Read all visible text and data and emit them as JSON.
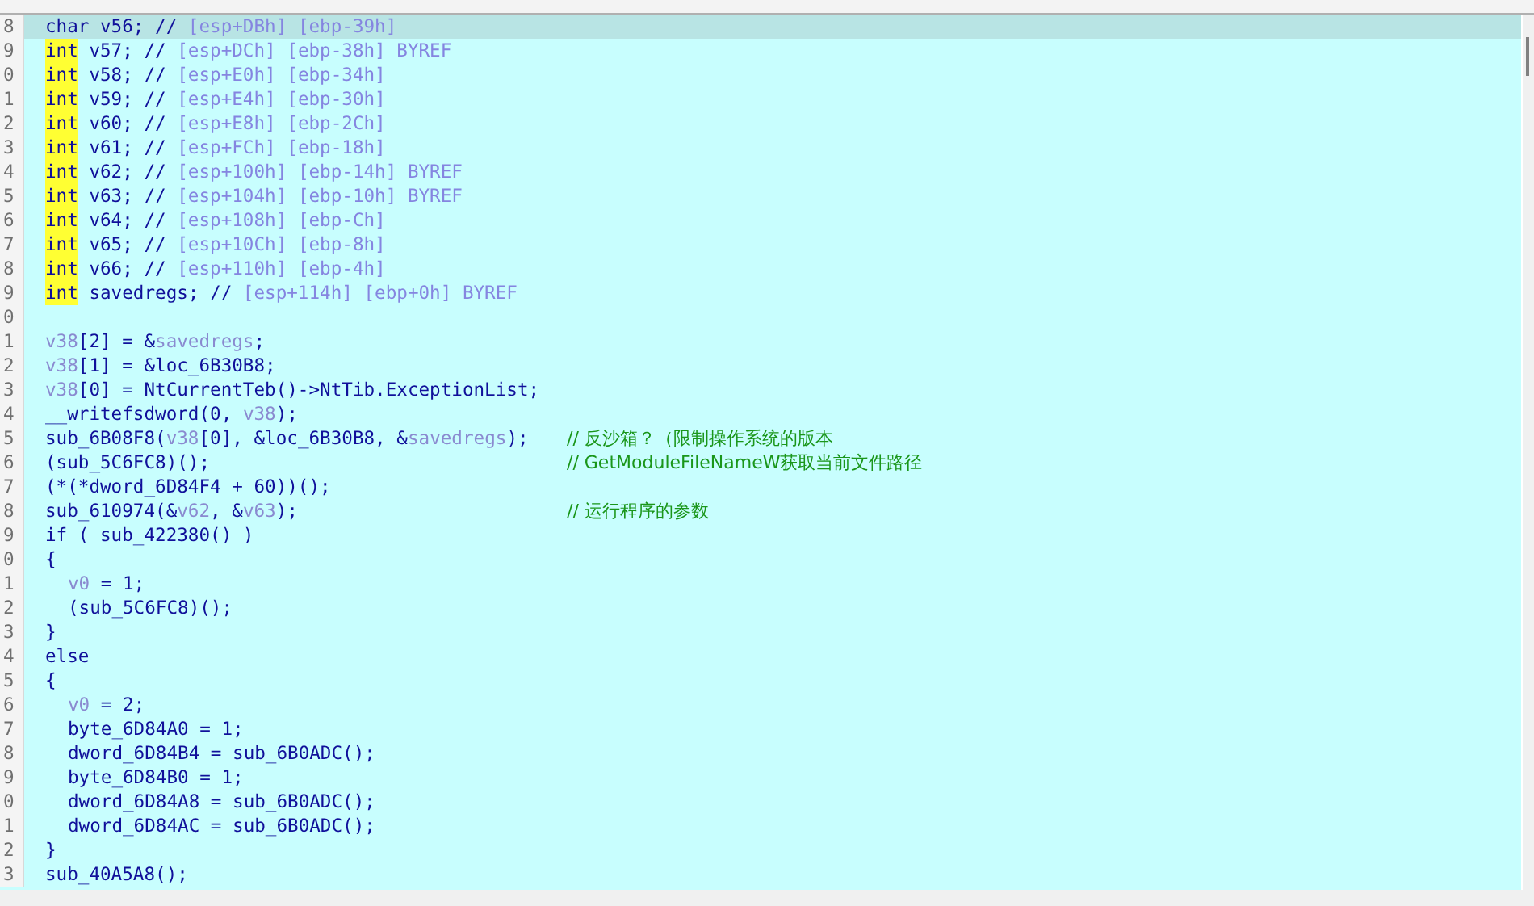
{
  "code_lines": [
    {
      "num": "8",
      "selected": true,
      "tokens": [
        {
          "text": "char v56; //",
          "kind": "plain"
        },
        {
          "text": " [esp+DBh] [ebp-39h]",
          "kind": "comment"
        }
      ]
    },
    {
      "num": "9",
      "selected": false,
      "tokens": [
        {
          "text": "int",
          "kind": "match"
        },
        {
          "text": " v57; //",
          "kind": "plain"
        },
        {
          "text": " [esp+DCh] [ebp-38h] BYREF",
          "kind": "comment"
        }
      ]
    },
    {
      "num": "0",
      "selected": false,
      "tokens": [
        {
          "text": "int",
          "kind": "match"
        },
        {
          "text": " v58; //",
          "kind": "plain"
        },
        {
          "text": " [esp+E0h] [ebp-34h]",
          "kind": "comment"
        }
      ]
    },
    {
      "num": "1",
      "selected": false,
      "tokens": [
        {
          "text": "int",
          "kind": "match"
        },
        {
          "text": " v59; //",
          "kind": "plain"
        },
        {
          "text": " [esp+E4h] [ebp-30h]",
          "kind": "comment"
        }
      ]
    },
    {
      "num": "2",
      "selected": false,
      "tokens": [
        {
          "text": "int",
          "kind": "match"
        },
        {
          "text": " v60; //",
          "kind": "plain"
        },
        {
          "text": " [esp+E8h] [ebp-2Ch]",
          "kind": "comment"
        }
      ]
    },
    {
      "num": "3",
      "selected": false,
      "tokens": [
        {
          "text": "int",
          "kind": "match"
        },
        {
          "text": " v61; //",
          "kind": "plain"
        },
        {
          "text": " [esp+FCh] [ebp-18h]",
          "kind": "comment"
        }
      ]
    },
    {
      "num": "4",
      "selected": false,
      "tokens": [
        {
          "text": "int",
          "kind": "match"
        },
        {
          "text": " v62; //",
          "kind": "plain"
        },
        {
          "text": " [esp+100h] [ebp-14h] BYREF",
          "kind": "comment"
        }
      ]
    },
    {
      "num": "5",
      "selected": false,
      "tokens": [
        {
          "text": "int",
          "kind": "match"
        },
        {
          "text": " v63; //",
          "kind": "plain"
        },
        {
          "text": " [esp+104h] [ebp-10h] BYREF",
          "kind": "comment"
        }
      ]
    },
    {
      "num": "6",
      "selected": false,
      "tokens": [
        {
          "text": "int",
          "kind": "match"
        },
        {
          "text": " v64; //",
          "kind": "plain"
        },
        {
          "text": " [esp+108h] [ebp-Ch]",
          "kind": "comment"
        }
      ]
    },
    {
      "num": "7",
      "selected": false,
      "tokens": [
        {
          "text": "int",
          "kind": "match"
        },
        {
          "text": " v65; //",
          "kind": "plain"
        },
        {
          "text": " [esp+10Ch] [ebp-8h]",
          "kind": "comment"
        }
      ]
    },
    {
      "num": "8",
      "selected": false,
      "tokens": [
        {
          "text": "int",
          "kind": "match"
        },
        {
          "text": " v66; //",
          "kind": "plain"
        },
        {
          "text": " [esp+110h] [ebp-4h]",
          "kind": "comment"
        }
      ]
    },
    {
      "num": "9",
      "selected": false,
      "tokens": [
        {
          "text": "int",
          "kind": "match"
        },
        {
          "text": " savedregs; //",
          "kind": "plain"
        },
        {
          "text": " [esp+114h] [ebp+0h] BYREF",
          "kind": "comment"
        }
      ]
    },
    {
      "num": "0",
      "selected": false
    },
    {
      "num": "1",
      "selected": false,
      "tokens": [
        {
          "text": "v38",
          "kind": "var"
        },
        {
          "text": "[2] = &",
          "kind": "plain"
        },
        {
          "text": "savedregs",
          "kind": "var"
        },
        {
          "text": ";",
          "kind": "plain"
        }
      ]
    },
    {
      "num": "2",
      "selected": false,
      "tokens": [
        {
          "text": "v38",
          "kind": "var"
        },
        {
          "text": "[1] = &loc_6B30B8;",
          "kind": "plain"
        }
      ]
    },
    {
      "num": "3",
      "selected": false,
      "tokens": [
        {
          "text": "v38",
          "kind": "var"
        },
        {
          "text": "[0] = NtCurrentTeb()->NtTib.ExceptionList;",
          "kind": "plain"
        }
      ]
    },
    {
      "num": "4",
      "selected": false,
      "tokens": [
        {
          "text": "__writefsdword(0, ",
          "kind": "plain"
        },
        {
          "text": "v38",
          "kind": "var"
        },
        {
          "text": ");",
          "kind": "plain"
        }
      ]
    },
    {
      "num": "5",
      "selected": false,
      "tokens": [
        {
          "text": "sub_6B08F8(",
          "kind": "plain"
        },
        {
          "text": "v38",
          "kind": "var"
        },
        {
          "text": "[0], &loc_6B30B8, &",
          "kind": "plain"
        },
        {
          "text": "savedregs",
          "kind": "var"
        },
        {
          "text": ");",
          "kind": "plain"
        },
        {
          "text": "// 反沙箱？（限制操作系统的版本",
          "kind": "note"
        }
      ]
    },
    {
      "num": "6",
      "selected": false,
      "tokens": [
        {
          "text": "(sub_5C6FC8)();",
          "kind": "plain"
        },
        {
          "text": "// GetModuleFileNameW获取当前文件路径",
          "kind": "note"
        }
      ]
    },
    {
      "num": "7",
      "selected": false,
      "tokens": [
        {
          "text": "(*(*dword_6D84F4 + 60))();",
          "kind": "plain"
        }
      ]
    },
    {
      "num": "8",
      "selected": false,
      "tokens": [
        {
          "text": "sub_610974(&",
          "kind": "plain"
        },
        {
          "text": "v62",
          "kind": "var"
        },
        {
          "text": ", &",
          "kind": "plain"
        },
        {
          "text": "v63",
          "kind": "var"
        },
        {
          "text": ");",
          "kind": "plain"
        },
        {
          "text": "// 运行程序的参数",
          "kind": "note"
        }
      ]
    },
    {
      "num": "9",
      "selected": false,
      "tokens": [
        {
          "text": "if ( sub_422380() )",
          "kind": "plain"
        }
      ]
    },
    {
      "num": "0",
      "selected": false,
      "tokens": [
        {
          "text": "{",
          "kind": "plain"
        }
      ]
    },
    {
      "num": "1",
      "selected": false,
      "indented": true,
      "tokens": [
        {
          "text": "v0",
          "kind": "var"
        },
        {
          "text": " = 1;",
          "kind": "plain"
        }
      ]
    },
    {
      "num": "2",
      "selected": false,
      "indented": true,
      "tokens": [
        {
          "text": "(sub_5C6FC8)();",
          "kind": "plain"
        }
      ]
    },
    {
      "num": "3",
      "selected": false,
      "tokens": [
        {
          "text": "}",
          "kind": "plain"
        }
      ]
    },
    {
      "num": "4",
      "selected": false,
      "tokens": [
        {
          "text": "else",
          "kind": "plain"
        }
      ]
    },
    {
      "num": "5",
      "selected": false,
      "tokens": [
        {
          "text": "{",
          "kind": "plain"
        }
      ]
    },
    {
      "num": "6",
      "selected": false,
      "indented": true,
      "tokens": [
        {
          "text": "v0",
          "kind": "var"
        },
        {
          "text": " = 2;",
          "kind": "plain"
        }
      ]
    },
    {
      "num": "7",
      "selected": false,
      "indented": true,
      "tokens": [
        {
          "text": "byte_6D84A0 = 1;",
          "kind": "plain"
        }
      ]
    },
    {
      "num": "8",
      "selected": false,
      "indented": true,
      "tokens": [
        {
          "text": "dword_6D84B4 = sub_6B0ADC();",
          "kind": "plain"
        }
      ]
    },
    {
      "num": "9",
      "selected": false,
      "indented": true,
      "tokens": [
        {
          "text": "byte_6D84B0 = 1;",
          "kind": "plain"
        }
      ]
    },
    {
      "num": "0",
      "selected": false,
      "indented": true,
      "tokens": [
        {
          "text": "dword_6D84A8 = sub_6B0ADC();",
          "kind": "plain"
        }
      ]
    },
    {
      "num": "1",
      "selected": false,
      "indented": true,
      "tokens": [
        {
          "text": "dword_6D84AC = sub_6B0ADC();",
          "kind": "plain"
        }
      ]
    },
    {
      "num": "2",
      "selected": false,
      "tokens": [
        {
          "text": "}",
          "kind": "plain"
        }
      ]
    },
    {
      "num": "3",
      "selected": false,
      "tokens": [
        {
          "text": "sub_40A5A8();",
          "kind": "plain"
        }
      ]
    }
  ]
}
